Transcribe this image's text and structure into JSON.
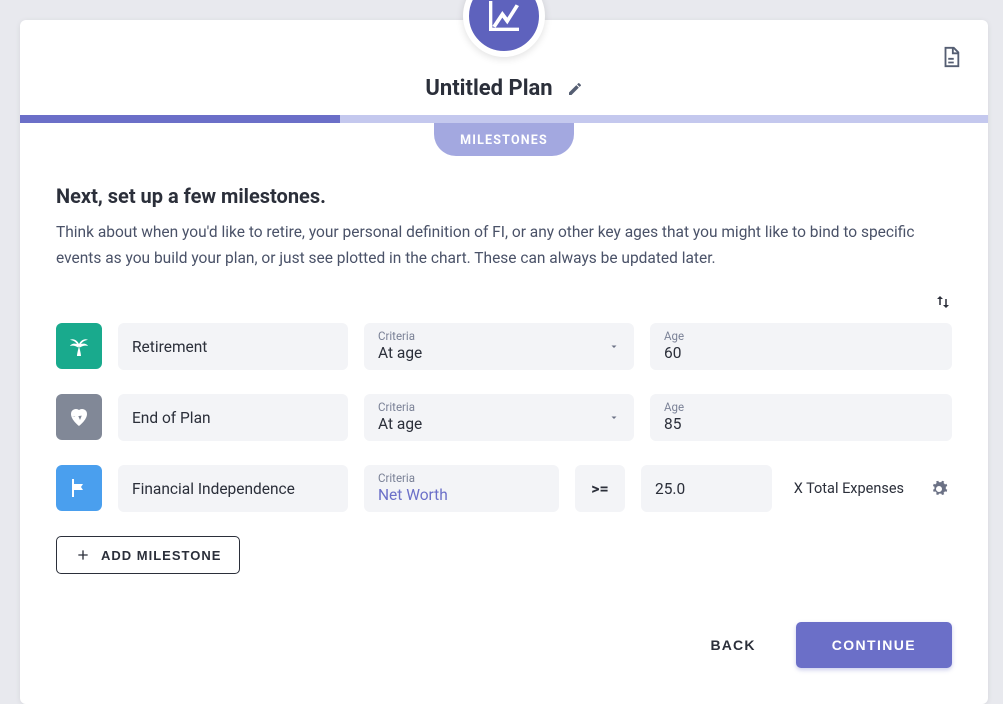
{
  "header": {
    "plan_title": "Untitled Plan",
    "progress_percent": 33.1,
    "tab_label": "MILESTONES"
  },
  "section": {
    "heading": "Next, set up a few milestones.",
    "subheading": "Think about when you'd like to retire, your personal definition of FI, or any other key ages that you might like to bind to specific events as you build your plan, or just see plotted in the chart. These can always be updated later."
  },
  "milestones": [
    {
      "icon": "palm",
      "icon_color": "teal",
      "name": "Retirement",
      "criteria_label": "Criteria",
      "criteria_value": "At age",
      "age_label": "Age",
      "age_value": "60"
    },
    {
      "icon": "heart",
      "icon_color": "gray",
      "name": "End of Plan",
      "criteria_label": "Criteria",
      "criteria_value": "At age",
      "age_label": "Age",
      "age_value": "85"
    },
    {
      "icon": "flag",
      "icon_color": "blue",
      "name": "Financial Independence",
      "criteria_label": "Criteria",
      "criteria_value": "Net Worth",
      "operator": ">=",
      "amount_value": "25.0",
      "suffix": "X Total Expenses"
    }
  ],
  "buttons": {
    "add_milestone": "ADD MILESTONE",
    "back": "BACK",
    "continue": "CONTINUE"
  }
}
